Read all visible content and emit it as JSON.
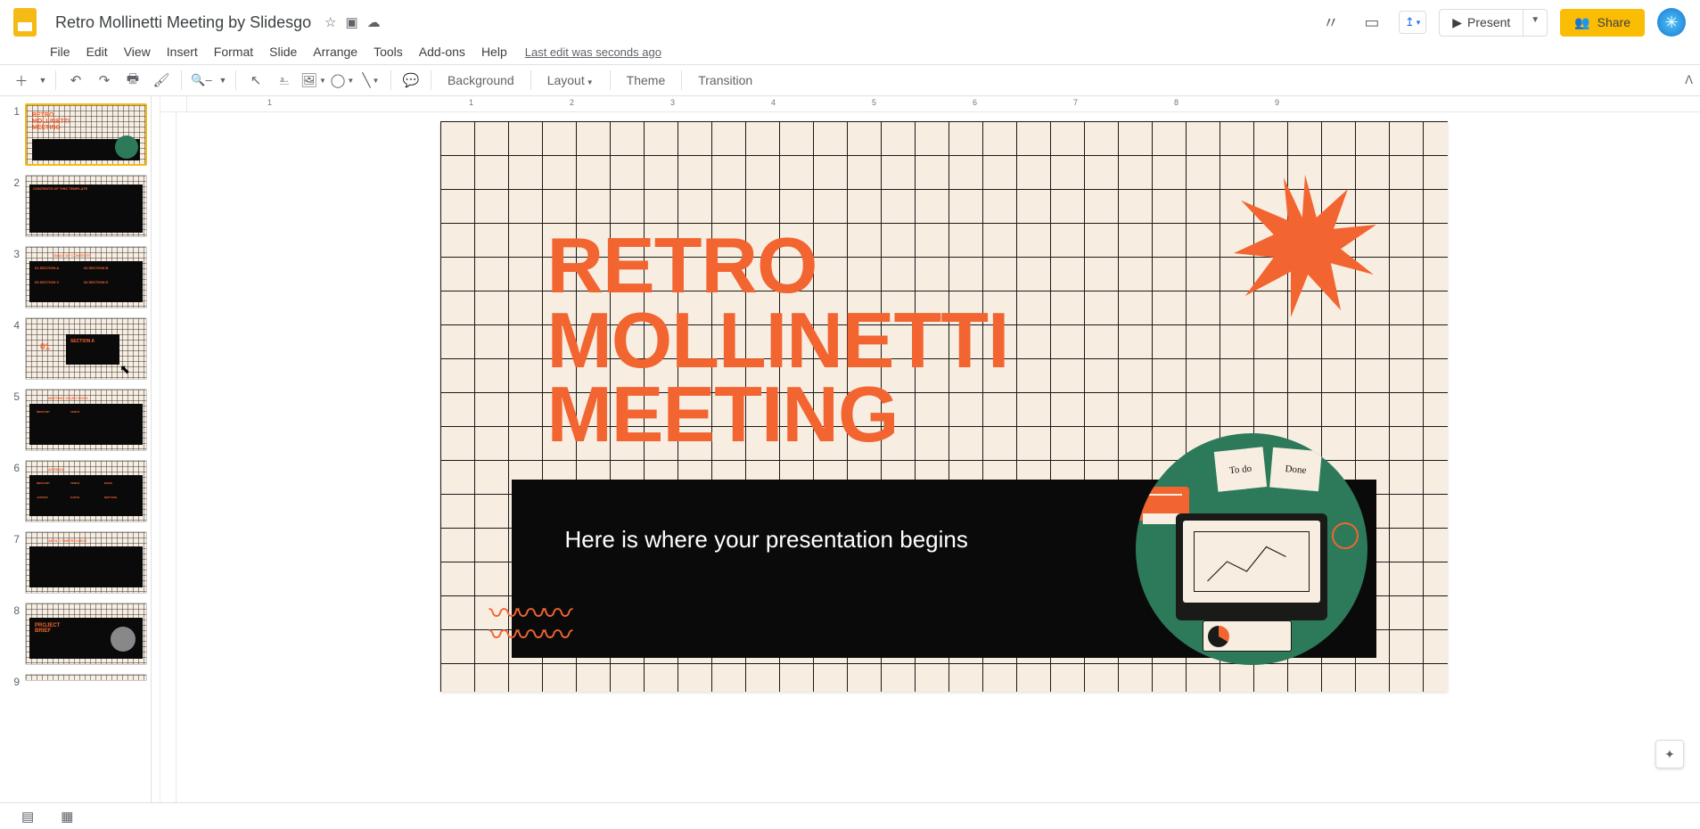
{
  "doc": {
    "title": "Retro Mollinetti Meeting by Slidesgo"
  },
  "menus": {
    "file": "File",
    "edit": "Edit",
    "view": "View",
    "insert": "Insert",
    "format": "Format",
    "slide": "Slide",
    "arrange": "Arrange",
    "tools": "Tools",
    "addons": "Add-ons",
    "help": "Help",
    "lastedit": "Last edit was seconds ago"
  },
  "buttons": {
    "present": "Present",
    "share": "Share"
  },
  "toolbar": {
    "background": "Background",
    "layout": "Layout",
    "theme": "Theme",
    "transition": "Transition"
  },
  "ruler": [
    "1",
    "",
    "1",
    "2",
    "3",
    "4",
    "5",
    "6",
    "7",
    "8",
    "9"
  ],
  "slide": {
    "title_l1": "RETRO",
    "title_l2": "MOLLINETTI",
    "title_l3": "MEETING",
    "subtitle": "Here is where your presentation begins",
    "sticky1": "To do",
    "sticky2": "Done"
  },
  "thumbs": [
    {
      "n": "1",
      "type": "title"
    },
    {
      "n": "2",
      "type": "contents",
      "label": "CONTENTS OF THIS TEMPLATE"
    },
    {
      "n": "3",
      "type": "toc",
      "label": "TABLE OF CONTENTS",
      "items": [
        "01 SECTION A",
        "02 SECTION B",
        "03 SECTION C",
        "04 SECTION D"
      ]
    },
    {
      "n": "4",
      "type": "section",
      "num": "01",
      "label": "SECTION A"
    },
    {
      "n": "5",
      "type": "objectives",
      "label": "MEETING OBJECTIVES",
      "cols": [
        "MERCURY",
        "VENUS"
      ]
    },
    {
      "n": "6",
      "type": "agenda",
      "label": "AGENDA",
      "cols": [
        "MERCURY",
        "VENUS",
        "MARS",
        "JUPITER",
        "EARTH",
        "NEPTUNE"
      ]
    },
    {
      "n": "7",
      "type": "about",
      "label": "ABOUT THE PROJECT"
    },
    {
      "n": "8",
      "type": "brief",
      "label": "PROJECT BRIEF"
    },
    {
      "n": "9",
      "type": "more"
    }
  ]
}
